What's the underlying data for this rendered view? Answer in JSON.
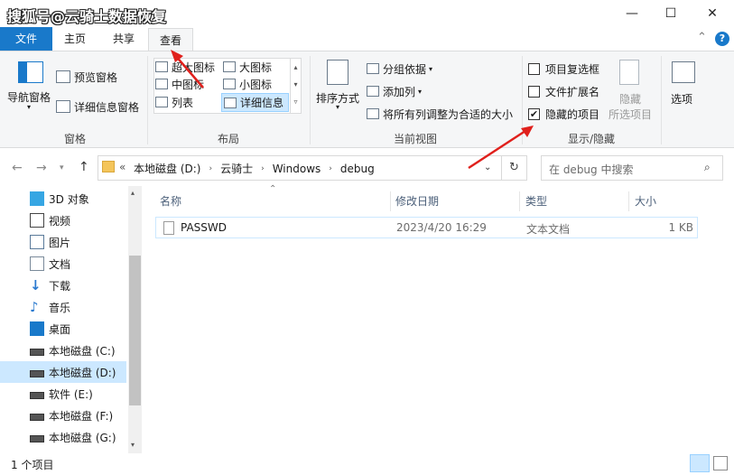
{
  "watermark": "搜狐号@云骑士数据恢复",
  "window_buttons": {
    "minimize": "—",
    "maximize": "☐",
    "close": "✕"
  },
  "tabs": {
    "file": "文件",
    "home": "主页",
    "share": "共享",
    "view": "查看"
  },
  "ribbon_chevron": "⌃",
  "help": "?",
  "ribbon": {
    "panes": {
      "nav_pane": "导航窗格",
      "preview_pane": "预览窗格",
      "details_pane": "详细信息窗格",
      "group_label": "窗格"
    },
    "layout": {
      "extra_large": "超大图标",
      "large": "大图标",
      "medium": "中图标",
      "small": "小图标",
      "list": "列表",
      "details": "详细信息",
      "group_label": "布局"
    },
    "current_view": {
      "sort_by": "排序方式",
      "group_by": "分组依据",
      "add_columns": "添加列",
      "size_all_columns": "将所有列调整为合适的大小",
      "group_label": "当前视图"
    },
    "show_hide": {
      "item_checkboxes": "项目复选框",
      "item_checkboxes_checked": false,
      "file_extensions": "文件扩展名",
      "file_extensions_checked": false,
      "hidden_items": "隐藏的项目",
      "hidden_items_checked": true,
      "hide": "隐藏",
      "hide_selected": "所选项目",
      "group_label": "显示/隐藏"
    },
    "options": "选项"
  },
  "address": {
    "overflow": "«",
    "crumbs": [
      "本地磁盘 (D:)",
      "云骑士",
      "Windows",
      "debug"
    ],
    "search_placeholder": "在 debug 中搜索"
  },
  "nav_items": [
    {
      "label": "3D 对象",
      "icon": "cube-3d-icon"
    },
    {
      "label": "视频",
      "icon": "video-icon"
    },
    {
      "label": "图片",
      "icon": "pictures-icon"
    },
    {
      "label": "文档",
      "icon": "documents-icon"
    },
    {
      "label": "下载",
      "icon": "download-icon"
    },
    {
      "label": "音乐",
      "icon": "music-icon"
    },
    {
      "label": "桌面",
      "icon": "desktop-icon"
    },
    {
      "label": "本地磁盘 (C:)",
      "icon": "drive-icon"
    },
    {
      "label": "本地磁盘 (D:)",
      "icon": "drive-icon",
      "selected": true
    },
    {
      "label": "软件 (E:)",
      "icon": "drive-icon"
    },
    {
      "label": "本地磁盘 (F:)",
      "icon": "drive-icon"
    },
    {
      "label": "本地磁盘 (G:)",
      "icon": "drive-icon"
    }
  ],
  "columns": {
    "name": "名称",
    "modified": "修改日期",
    "type": "类型",
    "size": "大小"
  },
  "files": [
    {
      "name": "PASSWD",
      "modified": "2023/4/20 16:29",
      "type": "文本文档",
      "size": "1 KB"
    }
  ],
  "status": {
    "count": "1 个项目"
  },
  "colors": {
    "accent": "#1979ca",
    "arrow": "#e0201c",
    "selected_bg": "#cce8ff"
  }
}
